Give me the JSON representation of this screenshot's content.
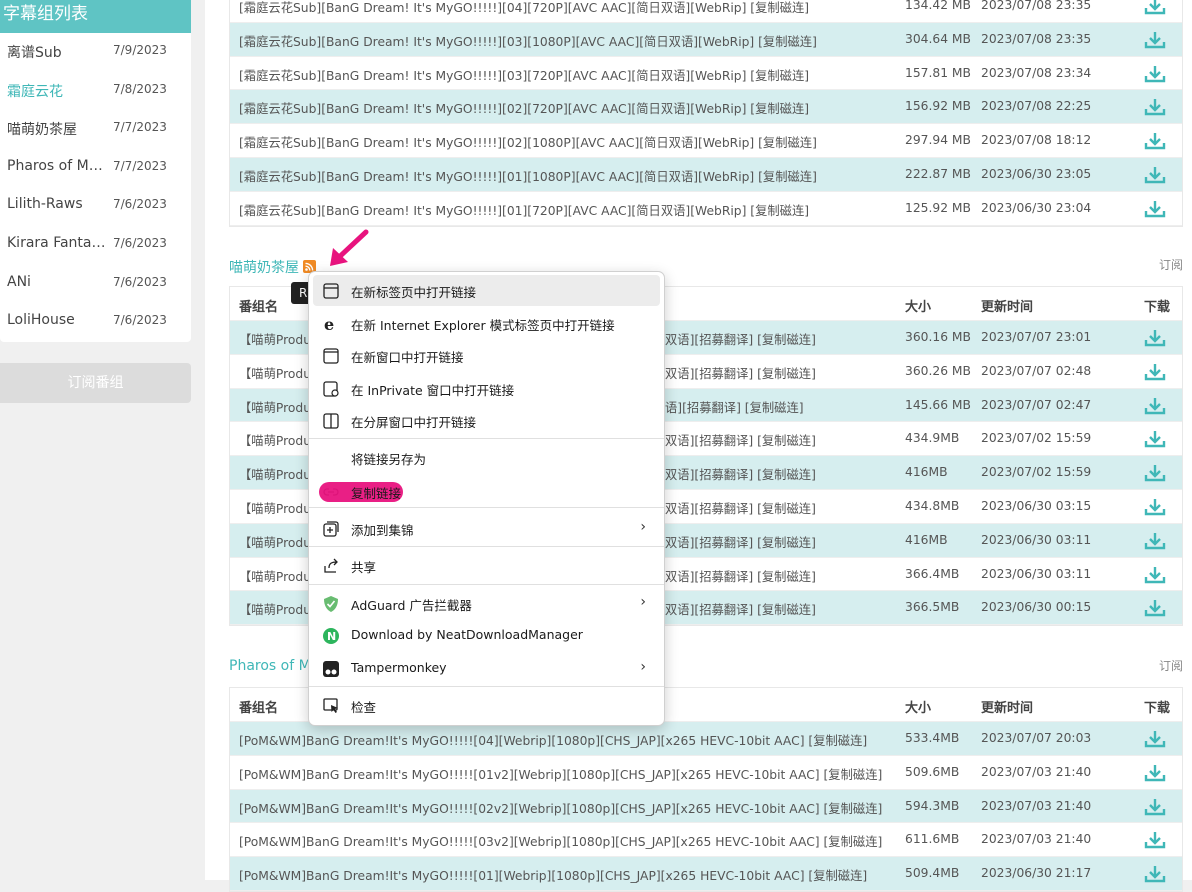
{
  "sidebar": {
    "header": "字幕组列表",
    "items": [
      {
        "name": "离谱Sub",
        "date": "7/9/2023",
        "active": false
      },
      {
        "name": "霜庭云花",
        "date": "7/8/2023",
        "active": true
      },
      {
        "name": "喵萌奶茶屋",
        "date": "7/7/2023",
        "active": false
      },
      {
        "name": "Pharos of MyGO",
        "date": "7/7/2023",
        "active": false
      },
      {
        "name": "Lilith-Raws",
        "date": "7/6/2023",
        "active": false
      },
      {
        "name": "Kirara Fantasia",
        "date": "7/6/2023",
        "active": false
      },
      {
        "name": "ANi",
        "date": "7/6/2023",
        "active": false
      },
      {
        "name": "LoliHouse",
        "date": "7/6/2023",
        "active": false
      }
    ],
    "subscribe_button": "订阅番组"
  },
  "colors": {
    "accent": "#5fc4c4",
    "row_alt": "#d6eeef",
    "rss": "#f08a24",
    "annotation": "#e8137e"
  },
  "table_headers": {
    "name": "番组名",
    "size": "大小",
    "updated": "更新时间",
    "download": "下载"
  },
  "sections": [
    {
      "title": "",
      "subscribe_label": "",
      "rows": [
        {
          "title": "[霜庭云花Sub][BanG Dream! It's MyGO!!!!!][04][720P][AVC AAC][简日双语][WebRip] [复制磁连]",
          "size": "134.42 MB",
          "date": "2023/07/08 23:35"
        },
        {
          "title": "[霜庭云花Sub][BanG Dream! It's MyGO!!!!!][03][1080P][AVC AAC][简日双语][WebRip] [复制磁连]",
          "size": "304.64 MB",
          "date": "2023/07/08 23:35"
        },
        {
          "title": "[霜庭云花Sub][BanG Dream! It's MyGO!!!!!][03][720P][AVC AAC][简日双语][WebRip] [复制磁连]",
          "size": "157.81 MB",
          "date": "2023/07/08 23:34"
        },
        {
          "title": "[霜庭云花Sub][BanG Dream! It's MyGO!!!!!][02][720P][AVC AAC][简日双语][WebRip] [复制磁连]",
          "size": "156.92 MB",
          "date": "2023/07/08 22:25"
        },
        {
          "title": "[霜庭云花Sub][BanG Dream! It's MyGO!!!!!][02][1080P][AVC AAC][简日双语][WebRip] [复制磁连]",
          "size": "297.94 MB",
          "date": "2023/07/08 18:12"
        },
        {
          "title": "[霜庭云花Sub][BanG Dream! It's MyGO!!!!!][01][1080P][AVC AAC][简日双语][WebRip] [复制磁连]",
          "size": "222.87 MB",
          "date": "2023/06/30 23:05"
        },
        {
          "title": "[霜庭云花Sub][BanG Dream! It's MyGO!!!!!][01][720P][AVC AAC][简日双语][WebRip] [复制磁连]",
          "size": "125.92 MB",
          "date": "2023/06/30 23:04"
        }
      ]
    },
    {
      "title": "喵萌奶茶屋",
      "subscribe_label": "订阅",
      "rows": [
        {
          "title": "【喵萌Produ",
          "tail": "双语][招募翻译] [复制磁连]",
          "size": "360.16 MB",
          "date": "2023/07/07 23:01"
        },
        {
          "title": "【喵萌Produ",
          "tail": "双语][招募翻译] [复制磁连]",
          "size": "360.26 MB",
          "date": "2023/07/07 02:48"
        },
        {
          "title": "【喵萌Produ",
          "tail": "语][招募翻译] [复制磁连]",
          "size": "145.66 MB",
          "date": "2023/07/07 02:47"
        },
        {
          "title": "【喵萌Produ",
          "tail": "双语][招募翻译] [复制磁连]",
          "size": "434.9MB",
          "date": "2023/07/02 15:59"
        },
        {
          "title": "【喵萌Produ",
          "tail": "双语][招募翻译] [复制磁连]",
          "size": "416MB",
          "date": "2023/07/02 15:59"
        },
        {
          "title": "【喵萌Produ",
          "tail": "双语][招募翻译] [复制磁连]",
          "size": "434.8MB",
          "date": "2023/06/30 03:15"
        },
        {
          "title": "【喵萌Produ",
          "tail": "双语][招募翻译] [复制磁连]",
          "size": "416MB",
          "date": "2023/06/30 03:11"
        },
        {
          "title": "【喵萌Produ",
          "tail": "双语][招募翻译] [复制磁连]",
          "size": "366.4MB",
          "date": "2023/06/30 03:11"
        },
        {
          "title": "【喵萌Produ",
          "tail": "双语][招募翻译] [复制磁连]",
          "size": "366.5MB",
          "date": "2023/06/30 00:15"
        }
      ]
    },
    {
      "title": "Pharos of My",
      "subscribe_label": "订阅",
      "rows": [
        {
          "title": "[PoM&WM]BanG Dream!It's MyGO!!!!![04][Webrip][1080p][CHS_JAP][x265 HEVC-10bit AAC] [复制磁连]",
          "size": "533.4MB",
          "date": "2023/07/07 20:03"
        },
        {
          "title": "[PoM&WM]BanG Dream!It's MyGO!!!!![01v2][Webrip][1080p][CHS_JAP][x265 HEVC-10bit AAC] [复制磁连]",
          "size": "509.6MB",
          "date": "2023/07/03 21:40"
        },
        {
          "title": "[PoM&WM]BanG Dream!It's MyGO!!!!![02v2][Webrip][1080p][CHS_JAP][x265 HEVC-10bit AAC] [复制磁连]",
          "size": "594.3MB",
          "date": "2023/07/03 21:40"
        },
        {
          "title": "[PoM&WM]BanG Dream!It's MyGO!!!!![03v2][Webrip][1080p][CHS_JAP][x265 HEVC-10bit AAC] [复制磁连]",
          "size": "611.6MB",
          "date": "2023/07/03 21:40"
        },
        {
          "title": "[PoM&WM]BanG Dream!It's MyGO!!!!![01][Webrip][1080p][CHS_JAP][x265 HEVC-10bit AAC] [复制磁连]",
          "size": "509.4MB",
          "date": "2023/06/30 21:17"
        }
      ]
    }
  ],
  "tooltip": "R",
  "context_menu": [
    {
      "label": "在新标签页中打开链接",
      "icon": "new-tab-icon",
      "submenu": false,
      "hover": true
    },
    {
      "label": "在新 Internet Explorer 模式标签页中打开链接",
      "icon": "ie-icon",
      "submenu": false
    },
    {
      "label": "在新窗口中打开链接",
      "icon": "new-window-icon",
      "submenu": false
    },
    {
      "label": "在 InPrivate 窗口中打开链接",
      "icon": "inprivate-icon",
      "submenu": false
    },
    {
      "label": "在分屏窗口中打开链接",
      "icon": "split-screen-icon",
      "submenu": false
    },
    {
      "label": "将链接另存为",
      "icon": "",
      "submenu": false
    },
    {
      "label": "复制链接",
      "icon": "link-icon",
      "submenu": false,
      "highlighted": true
    },
    {
      "label": "添加到集锦",
      "icon": "collections-icon",
      "submenu": true
    },
    {
      "label": "共享",
      "icon": "share-icon",
      "submenu": false
    },
    {
      "label": "AdGuard 广告拦截器",
      "icon": "adguard-icon",
      "submenu": true
    },
    {
      "label": "Download by NeatDownloadManager",
      "icon": "ndm-icon",
      "submenu": false
    },
    {
      "label": "Tampermonkey",
      "icon": "tampermonkey-icon",
      "submenu": true
    },
    {
      "label": "检查",
      "icon": "inspect-icon",
      "submenu": false
    }
  ]
}
